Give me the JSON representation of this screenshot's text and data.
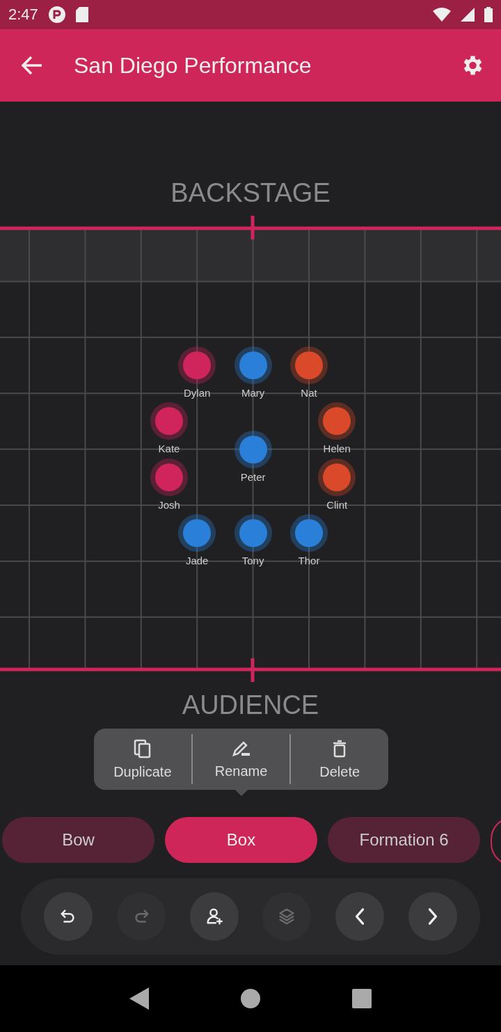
{
  "status_bar": {
    "time": "2:47"
  },
  "app_bar": {
    "title": "San Diego Performance"
  },
  "stage": {
    "top_label": "BACKSTAGE",
    "bottom_label": "AUDIENCE",
    "dancers": [
      {
        "name": "Dylan",
        "color": "#d0245c"
      },
      {
        "name": "Mary",
        "color": "#2a7fd8"
      },
      {
        "name": "Nat",
        "color": "#d9492a"
      },
      {
        "name": "Kate",
        "color": "#d0245c"
      },
      {
        "name": "Helen",
        "color": "#d9492a"
      },
      {
        "name": "Peter",
        "color": "#2a7fd8"
      },
      {
        "name": "Josh",
        "color": "#d0245c"
      },
      {
        "name": "Clint",
        "color": "#d9492a"
      },
      {
        "name": "Jade",
        "color": "#2a7fd8"
      },
      {
        "name": "Tony",
        "color": "#2a7fd8"
      },
      {
        "name": "Thor",
        "color": "#2a7fd8"
      }
    ]
  },
  "context_menu": [
    {
      "kind": "duplicate",
      "label": "Duplicate"
    },
    {
      "kind": "rename",
      "label": "Rename"
    },
    {
      "kind": "delete",
      "label": "Delete"
    }
  ],
  "formations": [
    {
      "label": "Bow",
      "selected": false
    },
    {
      "label": "Box",
      "selected": true
    },
    {
      "label": "Formation 6",
      "selected": false
    }
  ],
  "toolbar": [
    {
      "kind": "undo",
      "disabled": false
    },
    {
      "kind": "redo",
      "disabled": true
    },
    {
      "kind": "add-person",
      "disabled": false
    },
    {
      "kind": "layers",
      "disabled": true
    },
    {
      "kind": "previous",
      "disabled": false
    },
    {
      "kind": "next",
      "disabled": false
    }
  ]
}
